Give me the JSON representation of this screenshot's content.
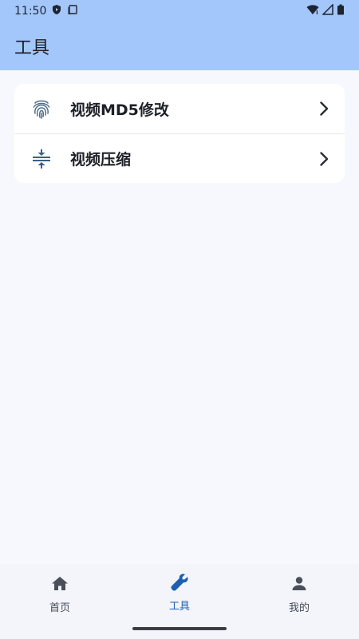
{
  "status_bar": {
    "time": "11:50"
  },
  "app_bar": {
    "title": "工具"
  },
  "tools": {
    "items": [
      {
        "label": "视频MD5修改",
        "icon": "fingerprint-icon"
      },
      {
        "label": "视频压缩",
        "icon": "compress-icon"
      }
    ]
  },
  "bottom_nav": {
    "items": [
      {
        "label": "首页",
        "icon": "home-icon",
        "active": false
      },
      {
        "label": "工具",
        "icon": "wrench-icon",
        "active": true
      },
      {
        "label": "我的",
        "icon": "person-icon",
        "active": false
      }
    ]
  },
  "colors": {
    "app_bar": "#a3c7fa",
    "background": "#f7f8fd",
    "accent": "#1d5fb0"
  }
}
